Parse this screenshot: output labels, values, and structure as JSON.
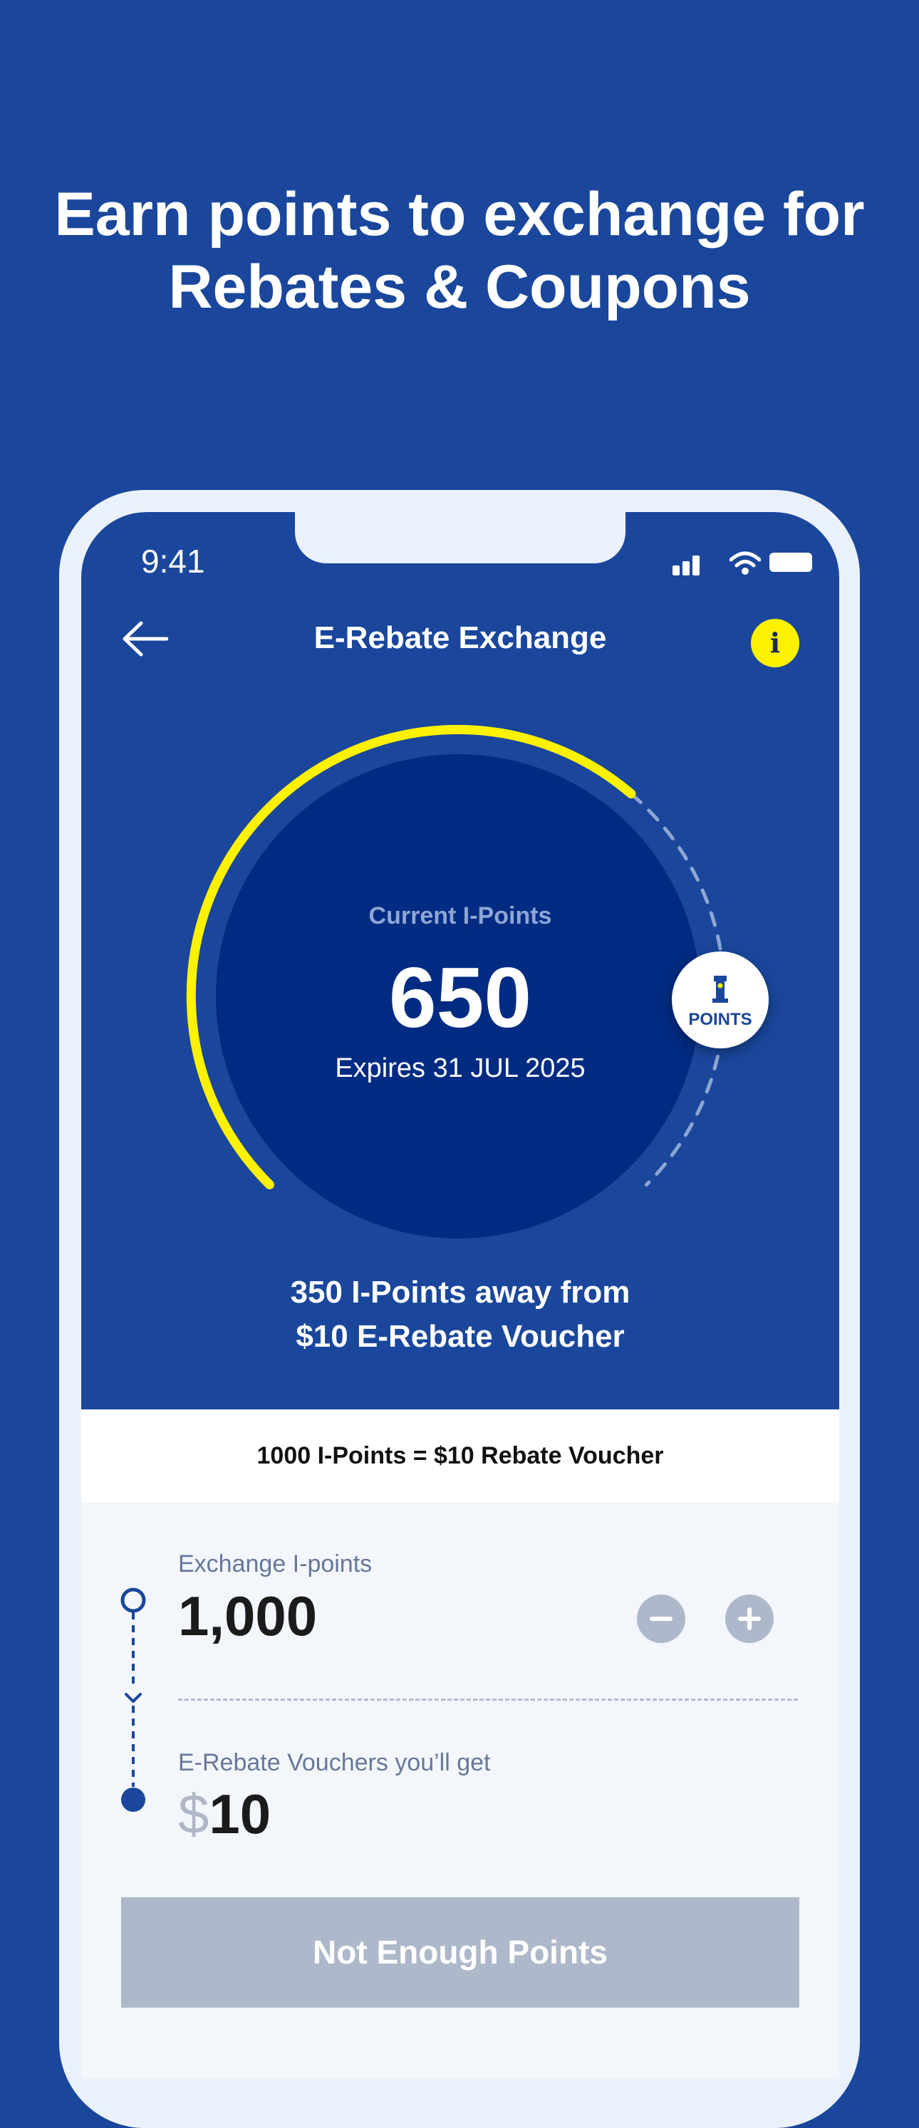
{
  "headline": "Earn points to exchange for Rebates & Coupons",
  "status_bar": {
    "time": "9:41"
  },
  "nav": {
    "title": "E-Rebate Exchange",
    "info_label": "i"
  },
  "gauge": {
    "caption": "Current I-Points",
    "points": "650",
    "expiry": "Expires 31 JUL 2025",
    "progress_fraction": 0.65,
    "badge_label": "POINTS"
  },
  "progress_message": "350 I-Points away from $10 E-Rebate Voucher",
  "progress_message_line1": "350 I-Points away from",
  "progress_message_line2": "$10 E-Rebate Voucher",
  "rate_text": "1000 I-Points = $10 Rebate Voucher",
  "exchange": {
    "label": "Exchange I-points",
    "value": "1,000"
  },
  "voucher": {
    "label": "E-Rebate Vouchers you’ll get",
    "currency": "$",
    "amount": "10"
  },
  "submit_label": "Not Enough Points",
  "colors": {
    "background": "#1a479c",
    "accent": "#fff200",
    "disc": "#002b82",
    "disabled": "#adb8cb"
  }
}
